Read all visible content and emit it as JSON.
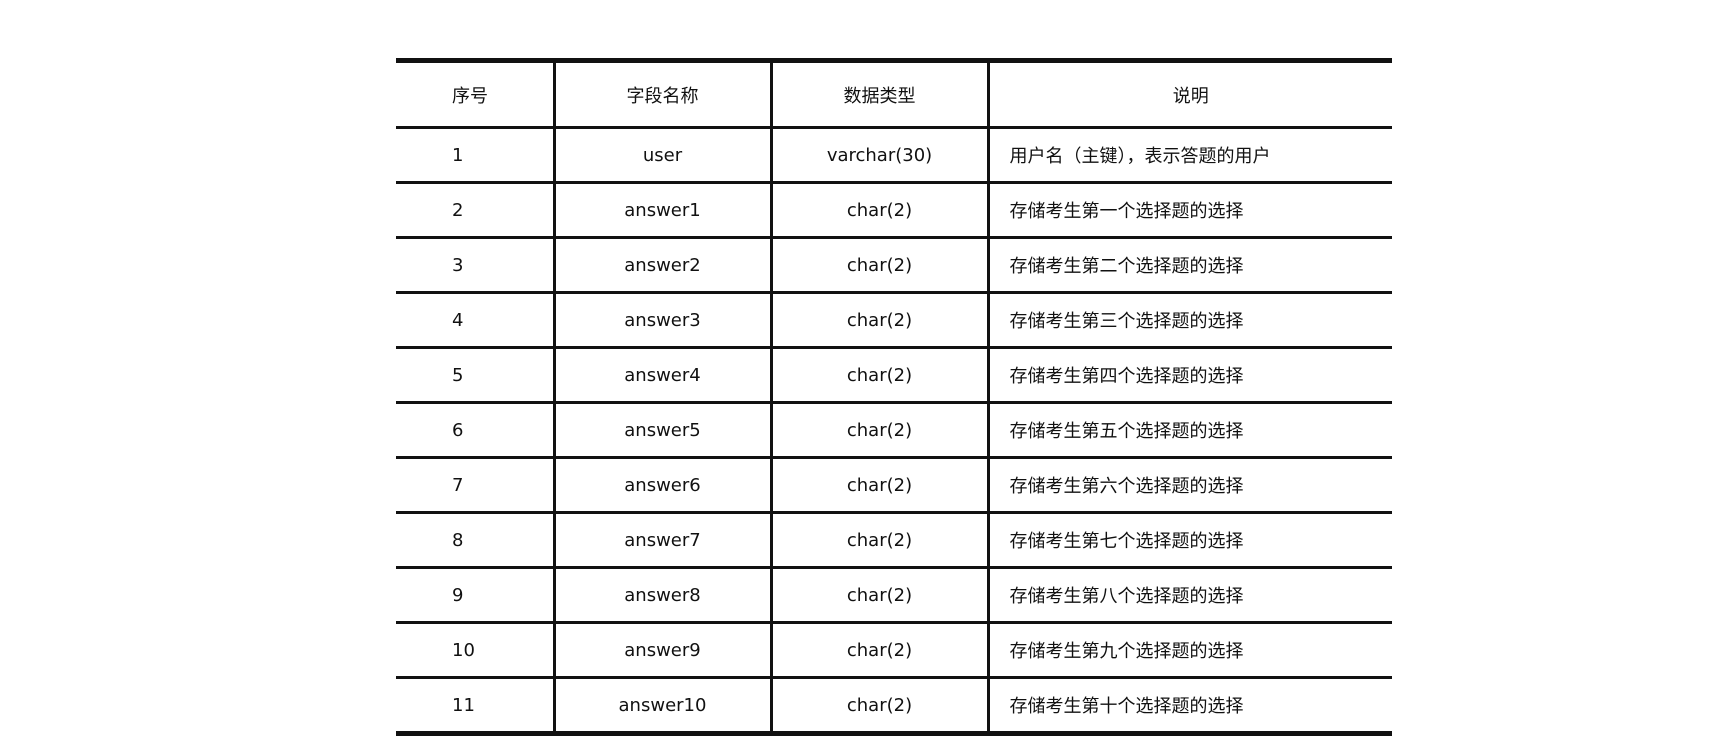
{
  "table": {
    "headers": {
      "index": "序号",
      "field_name": "字段名称",
      "data_type": "数据类型",
      "description": "说明"
    },
    "rows": [
      {
        "index": "1",
        "field_name": "user",
        "data_type": "varchar(30)",
        "description": "用户名（主键），表示答题的用户"
      },
      {
        "index": "2",
        "field_name": "answer1",
        "data_type": "char(2)",
        "description": "存储考生第一个选择题的选择"
      },
      {
        "index": "3",
        "field_name": "answer2",
        "data_type": "char(2)",
        "description": "存储考生第二个选择题的选择"
      },
      {
        "index": "4",
        "field_name": "answer3",
        "data_type": "char(2)",
        "description": "存储考生第三个选择题的选择"
      },
      {
        "index": "5",
        "field_name": "answer4",
        "data_type": "char(2)",
        "description": "存储考生第四个选择题的选择"
      },
      {
        "index": "6",
        "field_name": "answer5",
        "data_type": "char(2)",
        "description": "存储考生第五个选择题的选择"
      },
      {
        "index": "7",
        "field_name": "answer6",
        "data_type": "char(2)",
        "description": "存储考生第六个选择题的选择"
      },
      {
        "index": "8",
        "field_name": "answer7",
        "data_type": "char(2)",
        "description": "存储考生第七个选择题的选择"
      },
      {
        "index": "9",
        "field_name": "answer8",
        "data_type": "char(2)",
        "description": "存储考生第八个选择题的选择"
      },
      {
        "index": "10",
        "field_name": "answer9",
        "data_type": "char(2)",
        "description": "存储考生第九个选择题的选择"
      },
      {
        "index": "11",
        "field_name": "answer10",
        "data_type": "char(2)",
        "description": "存储考生第十个选择题的选择"
      }
    ]
  }
}
